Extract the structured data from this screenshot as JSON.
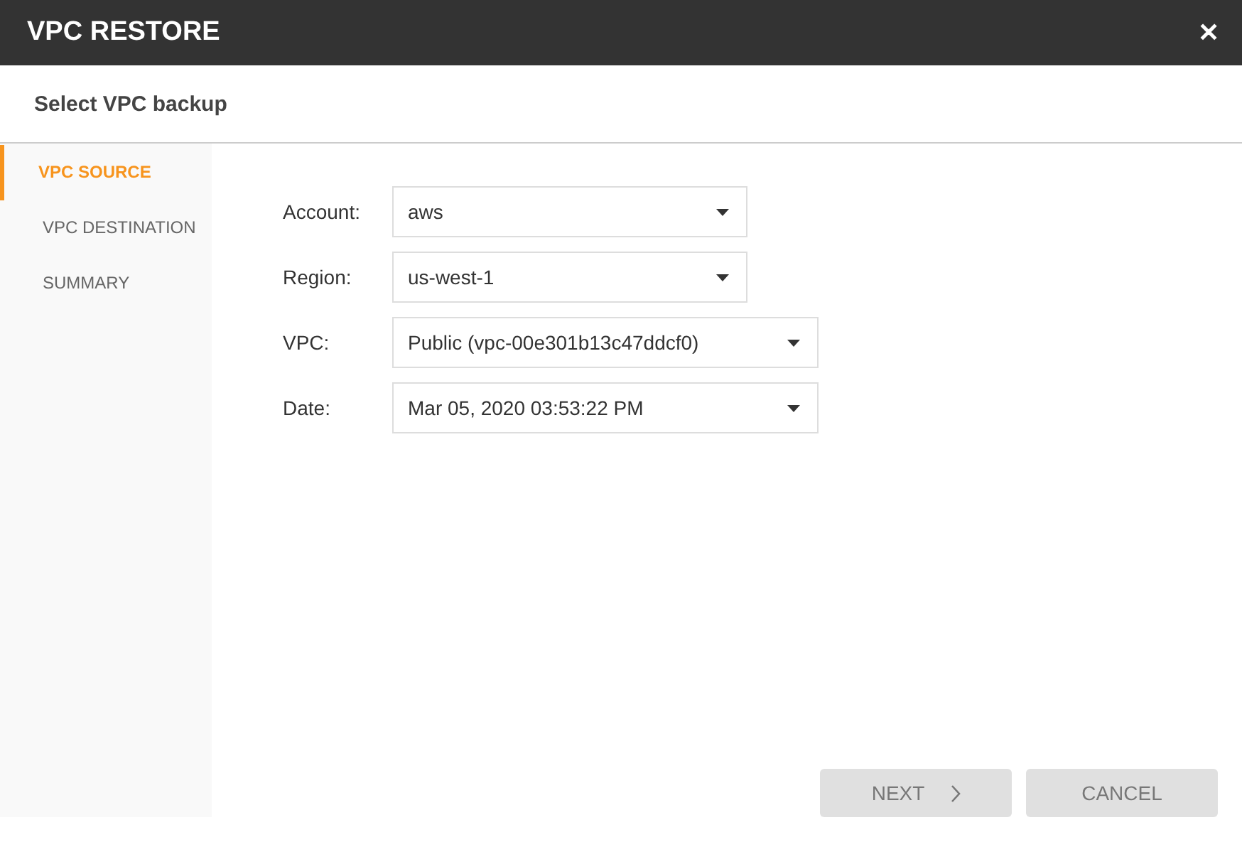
{
  "window": {
    "title": "VPC RESTORE",
    "close": "✕"
  },
  "heading": "Select VPC backup",
  "steps": [
    {
      "label": "VPC SOURCE",
      "selected": true
    },
    {
      "label": "VPC DESTINATION",
      "selected": false
    },
    {
      "label": "SUMMARY",
      "selected": false
    }
  ],
  "fields": [
    {
      "label": "Account:",
      "value": "aws"
    },
    {
      "label": "Region:",
      "value": "us-west-1"
    },
    {
      "label": "VPC:",
      "value": "Public (vpc-00e301b13c47ddcf0)"
    },
    {
      "label": "Date:",
      "value": "Mar 05, 2020 03:53:22 PM"
    }
  ],
  "buttons": [
    {
      "label": "NEXT",
      "kind": "next"
    },
    {
      "label": "CANCEL",
      "kind": "plain"
    }
  ]
}
